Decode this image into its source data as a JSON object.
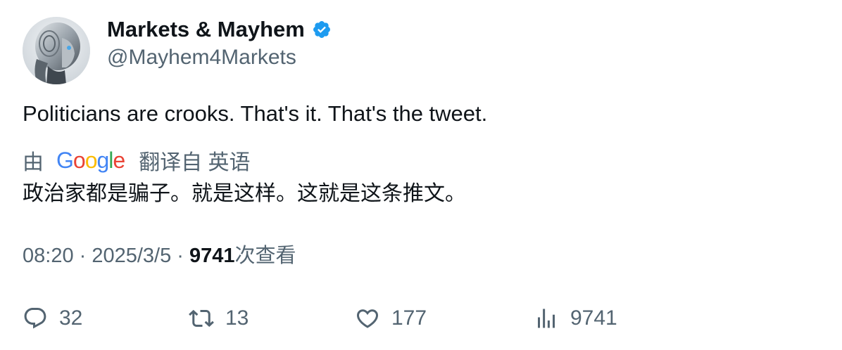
{
  "author": {
    "display_name": "Markets & Mayhem",
    "handle": "@Mayhem4Markets",
    "verified": true,
    "avatar_icon": "robot-avatar"
  },
  "tweet": {
    "text": "Politicians are crooks. That's it. That's the tweet."
  },
  "translation": {
    "by_label": "由",
    "provider_letters": [
      "G",
      "o",
      "o",
      "g",
      "l",
      "e"
    ],
    "label": "翻译自 英语",
    "text": "政治家都是骗子。就是这样。这就是这条推文。"
  },
  "meta": {
    "time": "08:20",
    "separator": " · ",
    "date": "2025/3/5",
    "views_count": "9741",
    "views_label": "次查看"
  },
  "actions": {
    "reply_count": "32",
    "retweet_count": "13",
    "like_count": "177",
    "views_count": "9741"
  },
  "colors": {
    "text_primary": "#0f1419",
    "text_secondary": "#536471",
    "verified_blue": "#1d9bf0",
    "google_blue": "#4285F4",
    "google_red": "#EA4335",
    "google_yellow": "#FBBC05",
    "google_green": "#34A853"
  }
}
